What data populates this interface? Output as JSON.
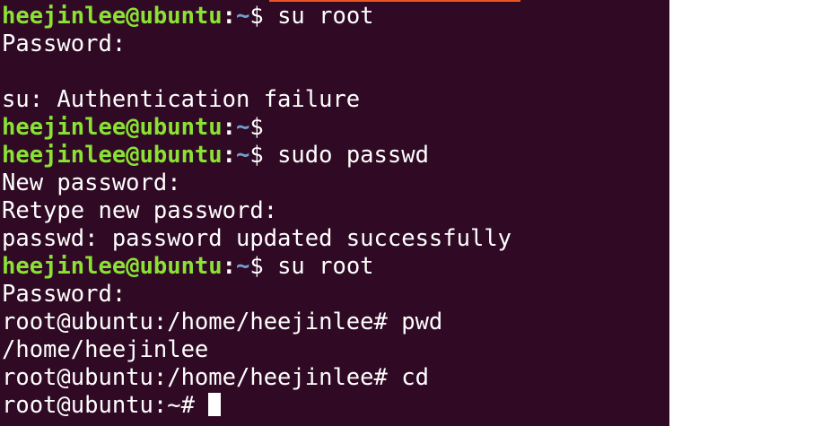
{
  "terminal": {
    "background_color": "#300a24",
    "user_prompt_color": "#8ae234",
    "path_color": "#729fcf",
    "lines": [
      {
        "user": "heejinlee@ubuntu",
        "sep": ":",
        "path": "~",
        "symbol": "$",
        "command": " su root"
      },
      {
        "text": "Password:"
      },
      {
        "text": ""
      },
      {
        "text": "su: Authentication failure"
      },
      {
        "user": "heejinlee@ubuntu",
        "sep": ":",
        "path": "~",
        "symbol": "$",
        "command": ""
      },
      {
        "user": "heejinlee@ubuntu",
        "sep": ":",
        "path": "~",
        "symbol": "$",
        "command": " sudo passwd"
      },
      {
        "text": "New password:"
      },
      {
        "text": "Retype new password:"
      },
      {
        "text": "passwd: password updated successfully"
      },
      {
        "user": "heejinlee@ubuntu",
        "sep": ":",
        "path": "~",
        "symbol": "$",
        "command": " su root"
      },
      {
        "text": "Password:"
      },
      {
        "text": "root@ubuntu:/home/heejinlee# pwd"
      },
      {
        "text": "/home/heejinlee"
      },
      {
        "text": "root@ubuntu:/home/heejinlee# cd"
      },
      {
        "text": "root@ubuntu:~# "
      }
    ]
  }
}
